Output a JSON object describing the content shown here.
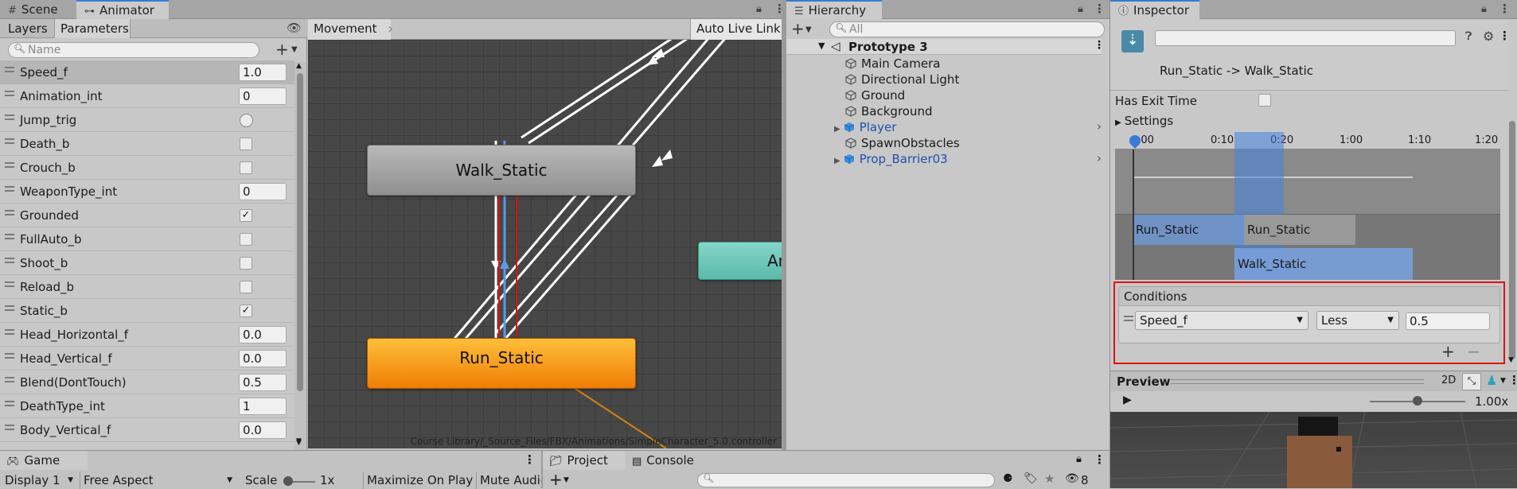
{
  "animator_panel": {
    "tabs": [
      {
        "label": "Scene"
      },
      {
        "label": "Animator"
      }
    ],
    "subtabs": [
      {
        "label": "Layers"
      },
      {
        "label": "Parameters"
      }
    ],
    "search_placeholder": "Name",
    "breadcrumb": "Movement",
    "auto_live_link": "Auto Live Link",
    "parameters": [
      {
        "name": "Speed_f",
        "value": "1.0"
      },
      {
        "name": "Animation_int",
        "value": "0"
      },
      {
        "name": "Jump_trig"
      },
      {
        "name": "Death_b"
      },
      {
        "name": "Crouch_b"
      },
      {
        "name": "WeaponType_int",
        "value": "0"
      },
      {
        "name": "Grounded",
        "check": "✓"
      },
      {
        "name": "FullAuto_b"
      },
      {
        "name": "Shoot_b"
      },
      {
        "name": "Reload_b"
      },
      {
        "name": "Static_b",
        "check": "✓"
      },
      {
        "name": "Head_Horizontal_f",
        "value": "0.0"
      },
      {
        "name": "Head_Vertical_f",
        "value": "0.0"
      },
      {
        "name": "Blend(DontTouch)",
        "value": "0.5"
      },
      {
        "name": "DeathType_int",
        "value": "1"
      },
      {
        "name": "Body_Vertical_f",
        "value": "0.0"
      }
    ],
    "nodes": {
      "walk": "Walk_Static",
      "run": "Run_Static",
      "partial": "An"
    },
    "footer_path": "Course Library/_Source_Files/FBX/Animations/SimpleCharacter_5.0.controller"
  },
  "hierarchy": {
    "tab": "Hierarchy",
    "search_placeholder": "All",
    "scene": "Prototype 3",
    "items": [
      {
        "label": "Main Camera"
      },
      {
        "label": "Directional Light"
      },
      {
        "label": "Ground"
      },
      {
        "label": "Background"
      },
      {
        "label": "Player"
      },
      {
        "label": "SpawnObstacles"
      },
      {
        "label": "Prop_Barrier03"
      }
    ]
  },
  "inspector": {
    "tab": "Inspector",
    "transition": "Run_Static -> Walk_Static",
    "has_exit_time": "Has Exit Time",
    "settings": "Settings",
    "ruler": [
      ":00",
      "0:10",
      "0:20",
      "1:00",
      "1:10",
      "1:20"
    ],
    "timeline_run_1": "Run_Static",
    "timeline_run_2": "Run_Static",
    "timeline_walk": "Walk_Static",
    "conditions_title": "Conditions",
    "condition": {
      "param": "Speed_f",
      "op": "Less",
      "value": "0.5"
    },
    "plus": "+",
    "minus": "−",
    "preview": "Preview",
    "preview_mode": "2D",
    "speed": "1.00x"
  },
  "bottom": {
    "game_tab": "Game",
    "display": "Display 1",
    "aspect": "Free Aspect",
    "scale_label": "Scale",
    "scale_value": "1x",
    "maximize": "Maximize On Play",
    "mute": "Mute Audio",
    "project_tab": "Project",
    "console_tab": "Console",
    "hidden_count": "8"
  },
  "colors": {
    "selection": "#3a79d8",
    "run_node": "#f28a0c",
    "walk_node": "#a9a9a9",
    "any_node": "#6ec7b8",
    "highlight": "#e01010"
  }
}
